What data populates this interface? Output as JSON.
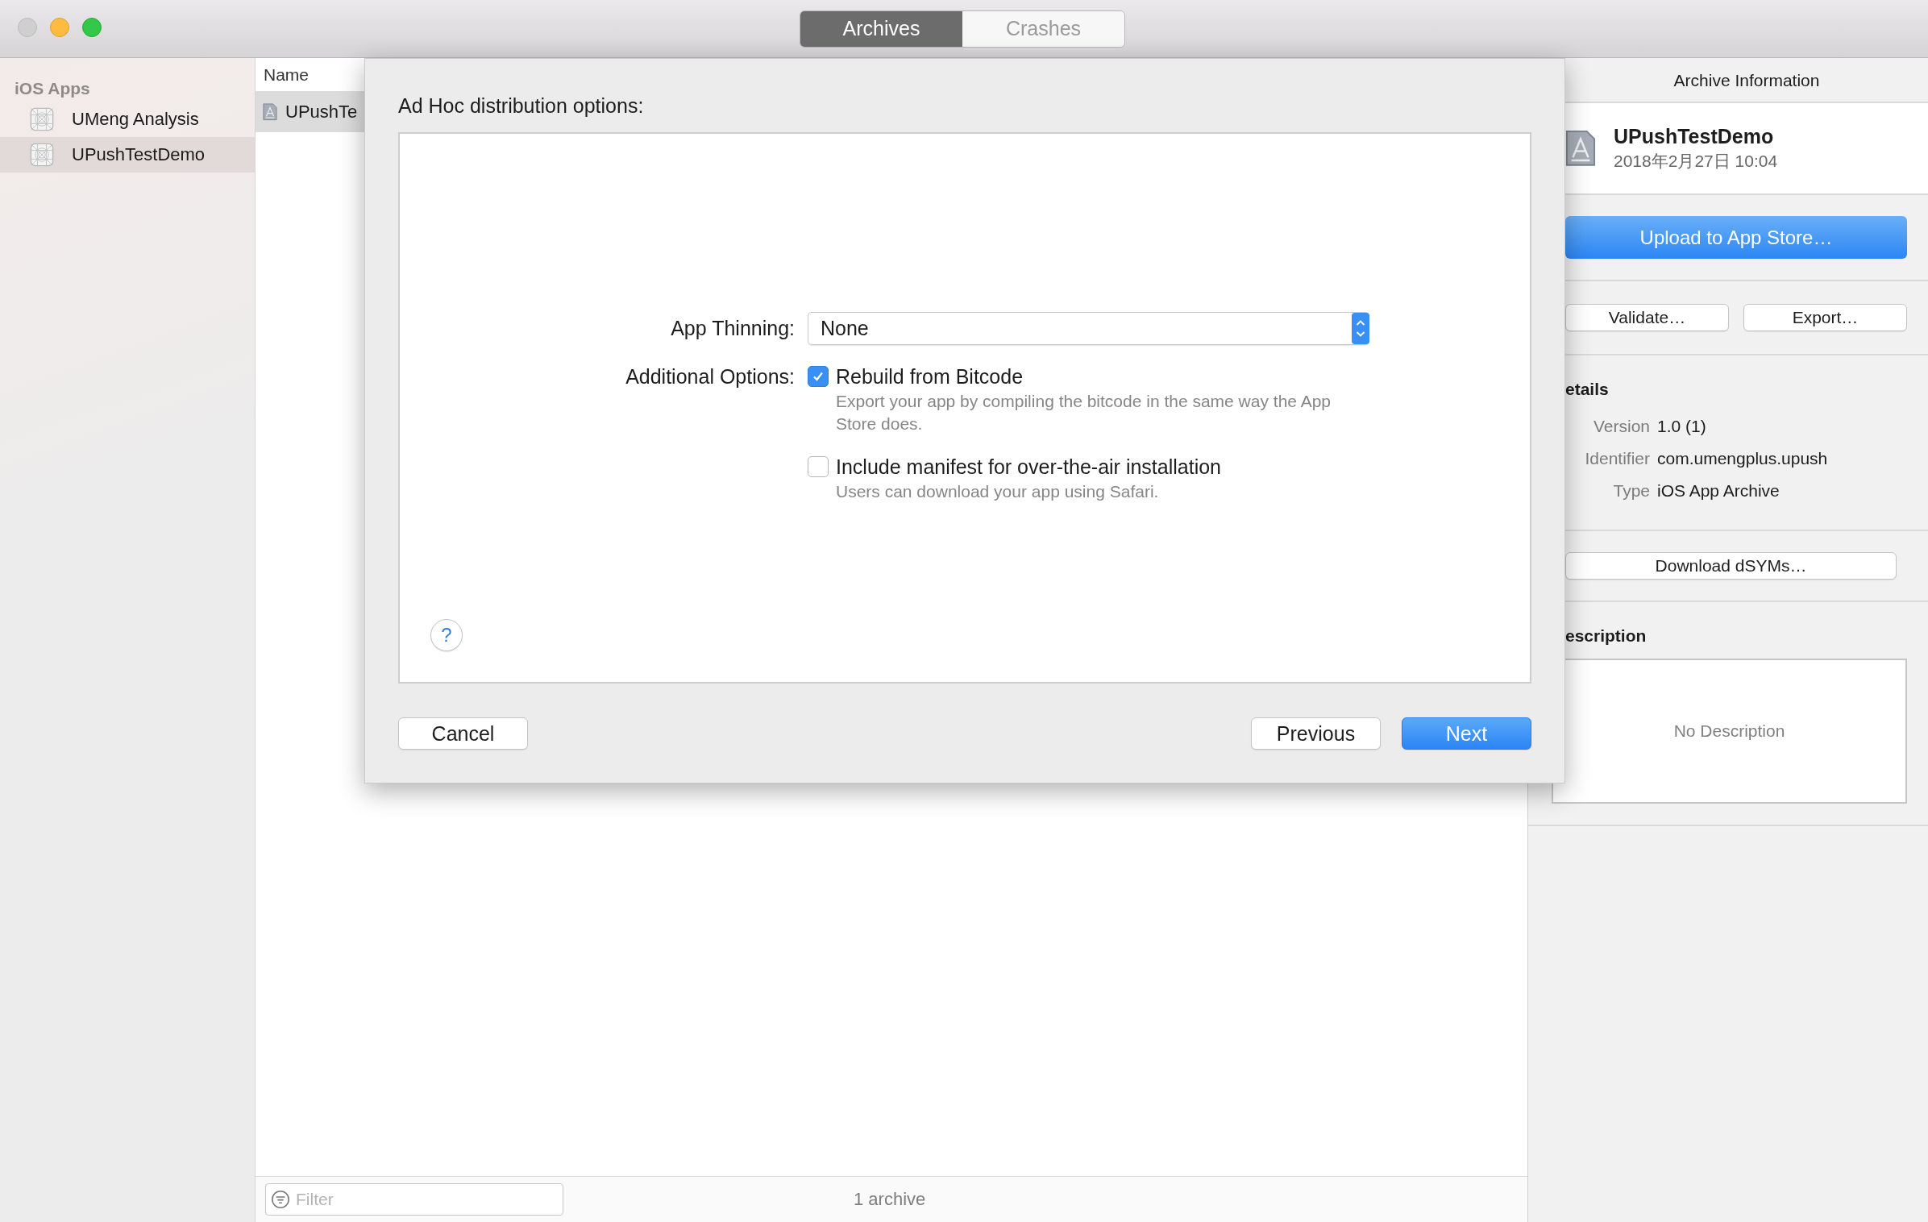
{
  "window": {
    "controls": [
      {
        "kind": "close",
        "disabled": true
      },
      {
        "kind": "minimize",
        "disabled": false
      },
      {
        "kind": "zoom",
        "disabled": false
      }
    ]
  },
  "toolbar": {
    "tabs": [
      {
        "label": "Archives",
        "selected": true
      },
      {
        "label": "Crashes",
        "selected": false
      }
    ]
  },
  "sidebar": {
    "header": "iOS Apps",
    "items": [
      {
        "label": "UMeng Analysis",
        "selected": false
      },
      {
        "label": "UPushTestDemo",
        "selected": true
      }
    ]
  },
  "archive_list": {
    "columns": [
      "Name"
    ],
    "rows": [
      {
        "name": "UPushTe",
        "selected": true
      }
    ],
    "filter": {
      "placeholder": "Filter"
    },
    "count": "1 archive"
  },
  "sheet": {
    "title": "Ad Hoc distribution options:",
    "app_thinning": {
      "label": "App Thinning:",
      "value": "None"
    },
    "options_label": "Additional Options:",
    "options": [
      {
        "label": "Rebuild from Bitcode",
        "description": "Export your app by compiling the bitcode in the same way the App Store does.",
        "checked": true
      },
      {
        "label": "Include manifest for over-the-air installation",
        "description": "Users can download your app using Safari.",
        "checked": false
      }
    ],
    "help": "?",
    "buttons": [
      {
        "label": "Cancel",
        "kind": "normal"
      },
      {
        "label": "Previous",
        "kind": "normal"
      },
      {
        "label": "Next",
        "kind": "default"
      }
    ]
  },
  "inspector": {
    "title": "Archive Information",
    "archive": {
      "name": "UPushTestDemo",
      "date": "2018年2月27日 10:04"
    },
    "primary_button": "Upload to App Store…",
    "buttons": [
      "Validate…",
      "Export…"
    ],
    "details": {
      "heading": "etails",
      "fields": [
        {
          "label": "Version",
          "value": "1.0 (1)"
        },
        {
          "label": "Identifier",
          "value": "com.umengplus.upush"
        },
        {
          "label": "Type",
          "value": "iOS App Archive"
        }
      ]
    },
    "dsyms_button": "Download dSYMs…",
    "description": {
      "heading": "escription",
      "empty_text": "No Description"
    }
  }
}
